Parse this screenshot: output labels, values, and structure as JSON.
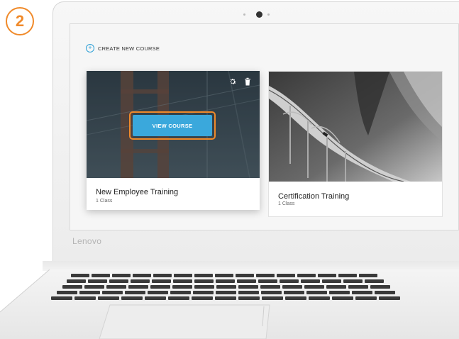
{
  "step": {
    "number": "2"
  },
  "laptop": {
    "brand": "Lenovo"
  },
  "toolbar": {
    "create_label": "CREATE NEW COURSE"
  },
  "courses": [
    {
      "title": "New Employee Training",
      "subtitle": "1 Class",
      "action_label": "VIEW COURSE"
    },
    {
      "title": "Certification Training",
      "subtitle": "1 Class"
    }
  ],
  "colors": {
    "accent": "#3aa8dc",
    "highlight": "#f08a2a"
  },
  "icons": {
    "create": "plus-circle-icon",
    "settings": "gear-icon",
    "delete": "trash-icon"
  }
}
